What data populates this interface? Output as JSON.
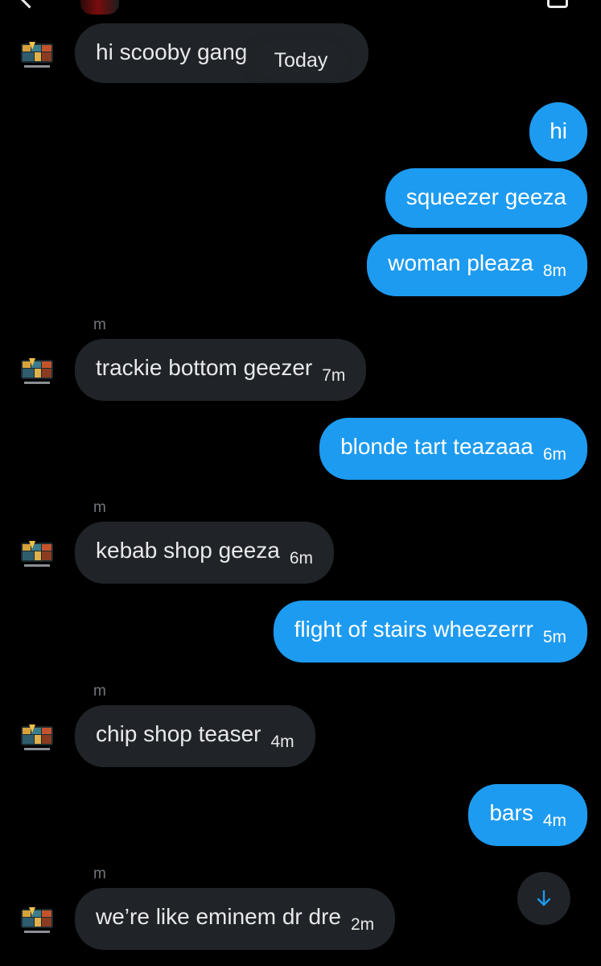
{
  "thread": {
    "today_label": "Today",
    "messages": [
      {
        "dir": "in",
        "text": "hi scooby gang",
        "time": ""
      },
      {
        "dir": "out",
        "text": "hi",
        "time": ""
      },
      {
        "dir": "out",
        "text": "squeezer geeza",
        "time": ""
      },
      {
        "dir": "out",
        "text": "woman pleaza",
        "time": "8m"
      },
      {
        "dir": "in",
        "sender": "m",
        "text": "trackie bottom geezer",
        "time": "7m"
      },
      {
        "dir": "out",
        "text": "blonde tart teazaaa",
        "time": "6m"
      },
      {
        "dir": "in",
        "sender": "m",
        "text": "kebab shop geeza",
        "time": "6m"
      },
      {
        "dir": "out",
        "text": "flight of stairs wheezerrr",
        "time": "5m"
      },
      {
        "dir": "in",
        "sender": "m",
        "text": "chip shop teaser",
        "time": "4m"
      },
      {
        "dir": "out",
        "text": "bars",
        "time": "4m"
      },
      {
        "dir": "in",
        "sender": "m",
        "text": "we’re like eminem dr dre",
        "time": "2m"
      }
    ]
  },
  "icons": {
    "avatar": "group-avatar-icon",
    "scroll": "arrow-down-icon"
  },
  "colors": {
    "background": "#000000",
    "incoming_bubble": "#202327",
    "outgoing_bubble": "#1d9bf0",
    "secondary_text": "#71767b",
    "accent": "#1d9bf0"
  }
}
